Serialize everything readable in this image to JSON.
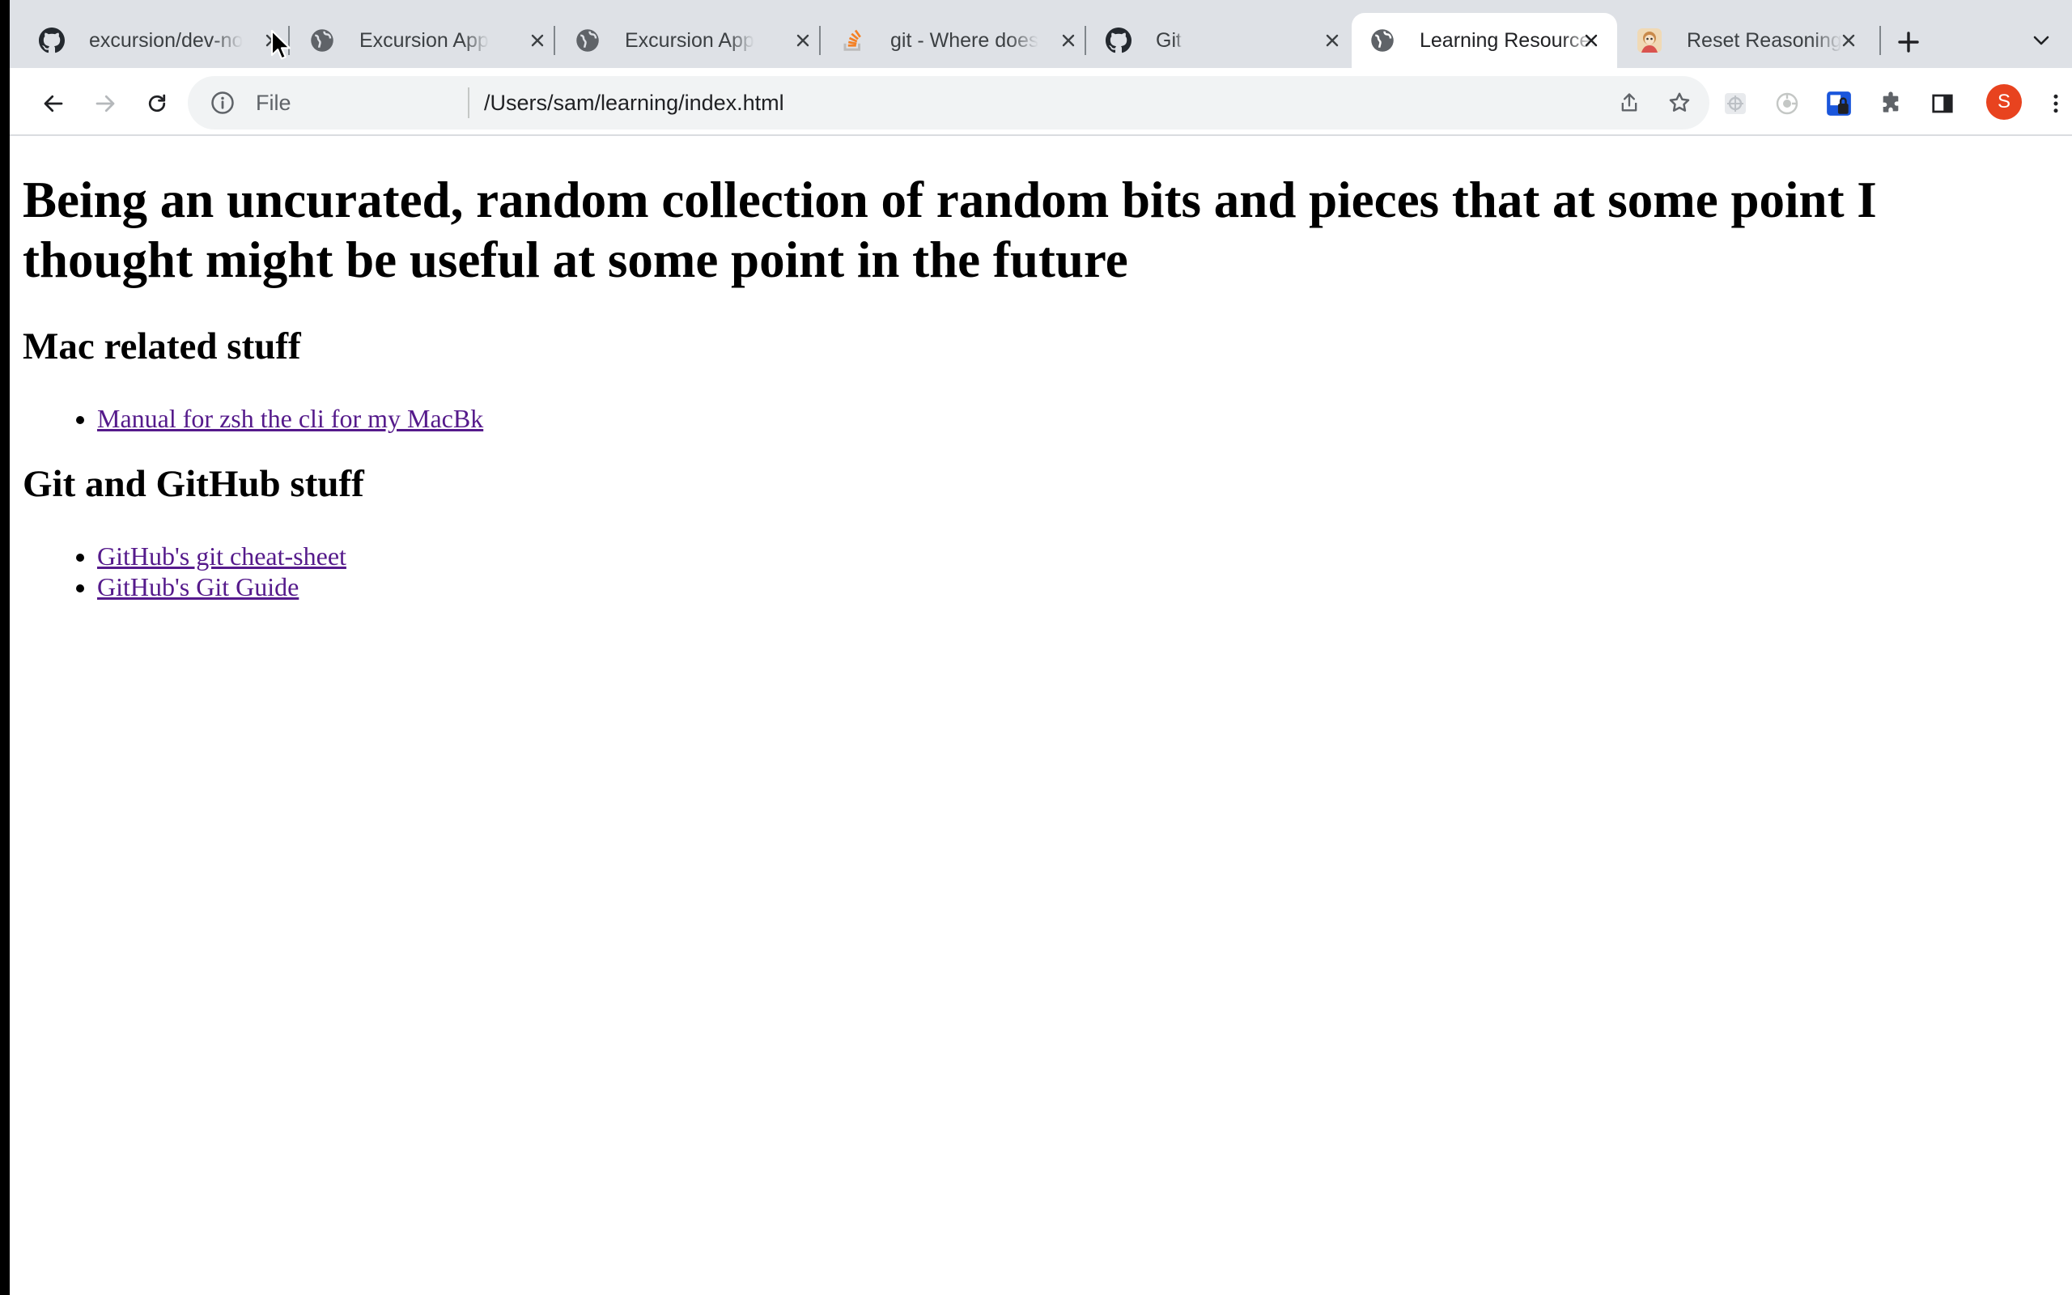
{
  "browser": {
    "tabs": [
      {
        "title": "excursion/dev-no",
        "favicon": "github-icon",
        "active": false
      },
      {
        "title": "Excursion App",
        "favicon": "globe-icon",
        "active": false
      },
      {
        "title": "Excursion App",
        "favicon": "globe-icon",
        "active": false
      },
      {
        "title": "git - Where does",
        "favicon": "stackoverflow-icon",
        "active": false
      },
      {
        "title": "Git",
        "favicon": "github-icon",
        "active": false
      },
      {
        "title": "Learning Resources",
        "favicon": "globe-icon",
        "active": true
      },
      {
        "title": "Reset Reasoning",
        "favicon": "avatar-favicon-icon",
        "active": false
      }
    ],
    "address_bar": {
      "chip": "File",
      "url": "/Users/sam/learning/index.html"
    },
    "profile_initial": "S",
    "colors": {
      "tabstrip": "#dee1e6",
      "omnibox": "#f1f3f4",
      "profile_avatar": "#e8431f",
      "visited_link": "#551a8b",
      "extension_blue": "#1a56db"
    }
  },
  "page": {
    "heading": "Being an uncurated, random collection of random bits and pieces that at some point I thought might be useful at some point in the future",
    "sections": [
      {
        "title": "Mac related stuff",
        "links": [
          "Manual for zsh the cli for my MacBk"
        ]
      },
      {
        "title": "Git and GitHub stuff",
        "links": [
          "GitHub's git cheat-sheet",
          "GitHub's Git Guide"
        ]
      }
    ]
  }
}
